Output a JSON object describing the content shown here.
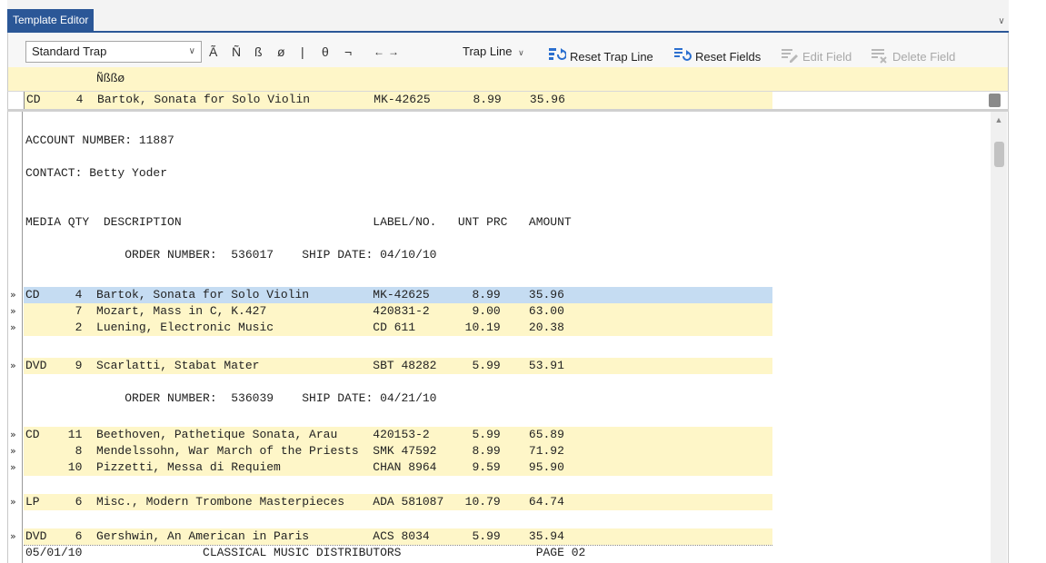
{
  "tab": {
    "title": "Template Editor"
  },
  "toolbar": {
    "trap_combo_value": "Standard Trap",
    "glyphs": [
      "Ã",
      "Ñ",
      "ß",
      "ø",
      "|",
      "θ",
      "¬",
      "←",
      "→"
    ],
    "trap_line_label": "Trap Line",
    "reset_trap_line_label": "Reset Trap Line",
    "reset_fields_label": "Reset Fields",
    "edit_field_label": "Edit Field",
    "delete_field_label": "Delete Field"
  },
  "header_row": {
    "text": "Ñßßø"
  },
  "sample_line": {
    "text": "CD     4  Bartok, Sonata for Solo Violin         MK-42625      8.99    35.96"
  },
  "colors": {
    "accent": "#2b5797",
    "highlight": "#fef6c8",
    "selected": "#c5dcf2"
  },
  "document": {
    "lines": [
      {
        "text": "",
        "style": "none",
        "mark": ""
      },
      {
        "text": "",
        "style": "none",
        "mark": ""
      },
      {
        "text": "ACCOUNT NUMBER: 11887",
        "style": "none",
        "mark": ""
      },
      {
        "text": "",
        "style": "none",
        "mark": ""
      },
      {
        "text": "CONTACT: Betty Yoder",
        "style": "none",
        "mark": ""
      },
      {
        "text": "",
        "style": "none",
        "mark": ""
      },
      {
        "text": "",
        "style": "none",
        "mark": ""
      },
      {
        "text": "MEDIA QTY  DESCRIPTION                           LABEL/NO.   UNT PRC   AMOUNT",
        "style": "none",
        "mark": ""
      },
      {
        "text": "",
        "style": "none",
        "mark": ""
      },
      {
        "text": "              ORDER NUMBER:  536017    SHIP DATE: 04/10/10",
        "style": "none",
        "mark": ""
      },
      {
        "text": "",
        "style": "none",
        "mark": ""
      },
      {
        "text": "CD     4  Bartok, Sonata for Solo Violin         MK-42625      8.99    35.96",
        "style": "blue",
        "mark": "»"
      },
      {
        "text": "       7  Mozart, Mass in C, K.427               420831-2      9.00    63.00",
        "style": "yellow",
        "mark": "»"
      },
      {
        "text": "       2  Luening, Electronic Music              CD 611       10.19    20.38",
        "style": "yellow",
        "mark": "»"
      },
      {
        "text": "",
        "style": "none",
        "mark": ""
      },
      {
        "text": "DVD    9  Scarlatti, Stabat Mater                SBT 48282     5.99    53.91",
        "style": "yellow",
        "mark": "»"
      },
      {
        "text": "",
        "style": "none",
        "mark": ""
      },
      {
        "text": "              ORDER NUMBER:  536039    SHIP DATE: 04/21/10",
        "style": "none",
        "mark": ""
      },
      {
        "text": "",
        "style": "none",
        "mark": ""
      },
      {
        "text": "CD    11  Beethoven, Pathetique Sonata, Arau     420153-2      5.99    65.89",
        "style": "yellow",
        "mark": "»"
      },
      {
        "text": "       8  Mendelssohn, War March of the Priests  SMK 47592     8.99    71.92",
        "style": "yellow",
        "mark": "»"
      },
      {
        "text": "      10  Pizzetti, Messa di Requiem             CHAN 8964     9.59    95.90",
        "style": "yellow",
        "mark": "»"
      },
      {
        "text": "",
        "style": "none",
        "mark": ""
      },
      {
        "text": "LP     6  Misc., Modern Trombone Masterpieces    ADA 581087   10.79    64.74",
        "style": "yellow",
        "mark": "»"
      },
      {
        "text": "",
        "style": "none",
        "mark": ""
      },
      {
        "text": "DVD    6  Gershwin, An American in Paris         ACS 8034      5.99    35.94",
        "style": "yellow",
        "mark": "»"
      },
      {
        "text": "05/01/10                 CLASSICAL MUSIC DISTRIBUTORS                   PAGE 02",
        "style": "footer",
        "mark": ""
      }
    ]
  }
}
